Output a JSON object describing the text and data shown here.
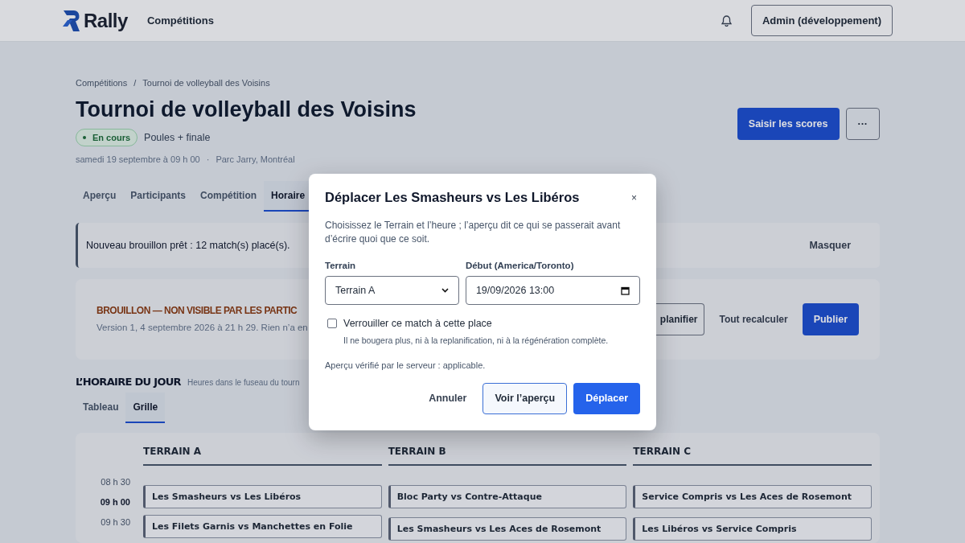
{
  "navbar": {
    "brand": "Rally",
    "links": [
      {
        "label": "Compétitions"
      }
    ],
    "account": "Admin (développement)"
  },
  "breadcrumb": [
    "Compétitions",
    "Tournoi de volleyball des Voisins"
  ],
  "breadcrumb_separator": "/",
  "meta_separator": "·",
  "title": "Tournoi de volleyball des Voisins",
  "status_badge": "En cours",
  "format": "Poules + finale",
  "date": "samedi 19 septembre à 09 h 00",
  "place": "Parc Jarry, Montréal",
  "actions": [
    {
      "label": "Saisir les scores",
      "kind": "primary"
    },
    {
      "label": "···",
      "kind": "outline"
    }
  ],
  "tabs": [
    {
      "label": "Aperçu",
      "selected": false
    },
    {
      "label": "Participants",
      "selected": false
    },
    {
      "label": "Compétition",
      "selected": false
    },
    {
      "label": "Horaire",
      "selected": true
    }
  ],
  "notice": {
    "text": "Nouveau brouillon prêt : 12 match(s) placé(s).",
    "action": "Masquer"
  },
  "draft": {
    "title": "BROUILLON — NON VISIBLE PAR LES PARTIC",
    "text": "Version 1, 4 septembre 2026 à 21 h 29. Rien n’a en",
    "buttons": [
      {
        "label": "planifier",
        "kind": "outline"
      },
      {
        "label": "Tout recalculer",
        "kind": "link"
      },
      {
        "label": "Publier",
        "kind": "primary"
      }
    ]
  },
  "schedule": {
    "title": "L’HORAIRE DU JOUR",
    "note": "Heures dans le fuseau du tourn",
    "views": [
      {
        "label": "Tableau",
        "selected": false
      },
      {
        "label": "Grille",
        "selected": true
      }
    ],
    "times": [
      {
        "label": "08 h 30",
        "kind": "half"
      },
      {
        "label": "09 h 00",
        "kind": "hour"
      },
      {
        "label": "09 h 30",
        "kind": "half"
      }
    ],
    "courts": [
      {
        "name": "TERRAIN A",
        "matches": [
          "Les Smasheurs vs Les Libéros",
          "Les Filets Garnis vs Manchettes en Folie"
        ]
      },
      {
        "name": "TERRAIN B",
        "matches": [
          "Bloc Party vs Contre-Attaque",
          "Les Smasheurs vs Les Aces de Rosemont"
        ]
      },
      {
        "name": "TERRAIN C",
        "matches": [
          "Service Compris vs Les Aces de Rosemont",
          "Les Libéros vs Service Compris"
        ]
      }
    ]
  },
  "modal": {
    "title": "Déplacer Les Smasheurs vs Les Libéros",
    "close": "×",
    "intro": "Choisissez le Terrain et l’heure ; l’aperçu dit ce qui se passerait avant d’écrire quoi que ce soit.",
    "court_label": "Terrain",
    "court_value": "Terrain A",
    "start_label": "Début (America/Toronto)",
    "start_value": "19/09/2026 13:00",
    "lock": {
      "label": "Verrouiller ce match à cette place",
      "checked": false,
      "help": "Il ne bougera plus, ni à la replanification, ni à la régénération complète."
    },
    "status": "Aperçu vérifié par le serveur : applicable.",
    "buttons": [
      {
        "label": "Annuler",
        "kind": "link"
      },
      {
        "label": "Voir l’aperçu",
        "kind": "outline"
      },
      {
        "label": "Déplacer",
        "kind": "primary"
      }
    ]
  }
}
